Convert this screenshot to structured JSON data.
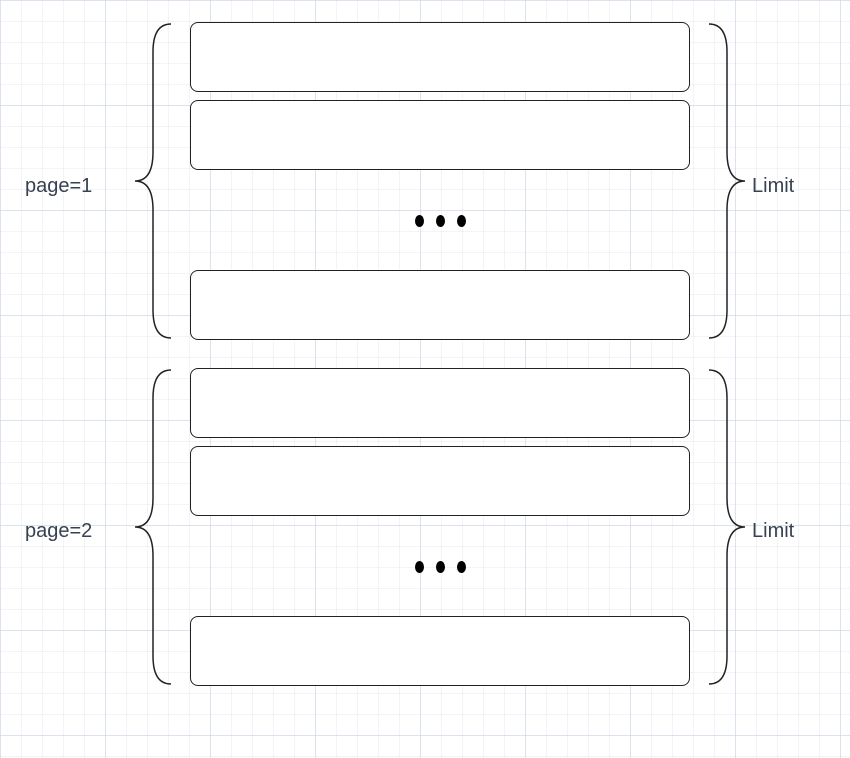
{
  "labels": {
    "page1": "page=1",
    "page2": "page=2",
    "limit1": "Limit",
    "limit2": "Limit"
  },
  "chart_data": {
    "type": "table",
    "description": "Pagination diagram showing two pages of rows, each page grouped by curly braces with page label on left and Limit label on right. Each page shows some rows with an ellipsis indicating more rows in between.",
    "pages": [
      {
        "name": "page=1",
        "left_label": "page=1",
        "right_label": "Limit",
        "shown_rows_before_ellipsis": 2,
        "ellipsis": true,
        "shown_rows_after_ellipsis": 1
      },
      {
        "name": "page=2",
        "left_label": "page=2",
        "right_label": "Limit",
        "shown_rows_before_ellipsis": 2,
        "ellipsis": true,
        "shown_rows_after_ellipsis": 1
      }
    ]
  }
}
